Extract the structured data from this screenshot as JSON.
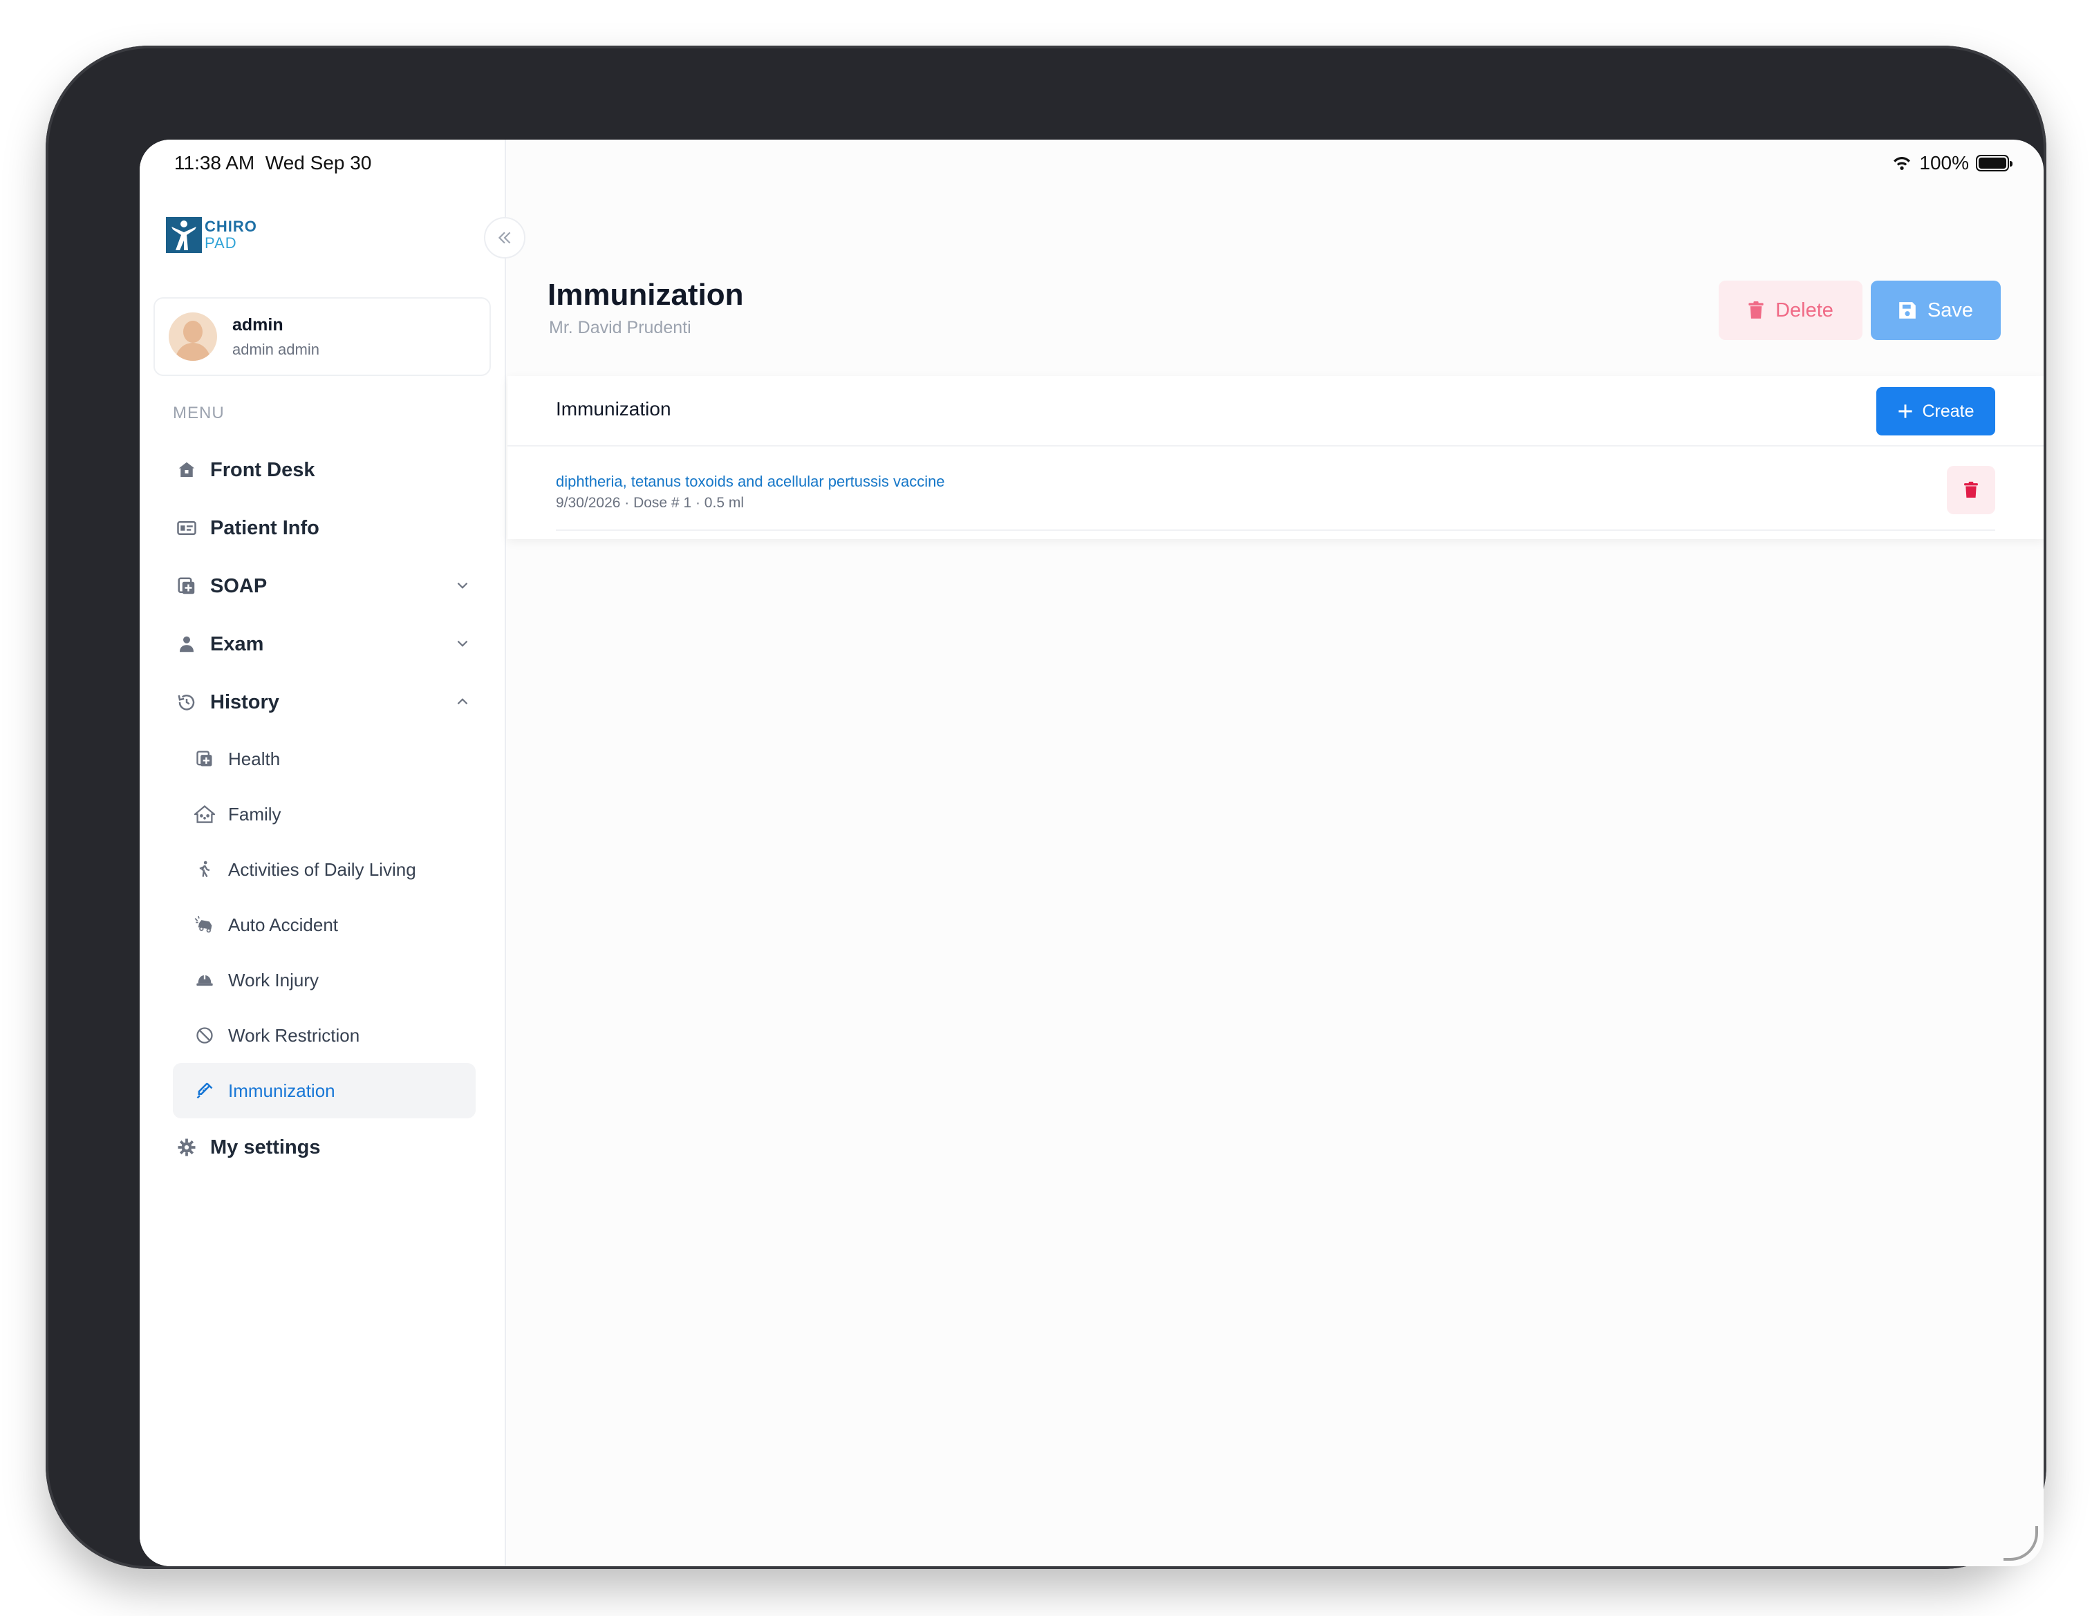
{
  "status_bar": {
    "time": "11:38 AM",
    "date": "Wed Sep 30",
    "battery": "100%"
  },
  "logo": {
    "line1": "CHIRO",
    "line2": "PAD"
  },
  "user": {
    "name": "admin",
    "subtitle": "admin admin"
  },
  "menu": {
    "heading": "MENU",
    "items": [
      {
        "label": "Front Desk",
        "icon": "home-icon"
      },
      {
        "label": "Patient Info",
        "icon": "id-card-icon"
      },
      {
        "label": "SOAP",
        "icon": "medical-doc-icon",
        "expandable": true
      },
      {
        "label": "Exam",
        "icon": "doctor-icon",
        "expandable": true
      },
      {
        "label": "History",
        "icon": "history-icon",
        "expanded": true
      }
    ],
    "history_sub": [
      {
        "label": "Health",
        "icon": "health-icon"
      },
      {
        "label": "Family",
        "icon": "family-icon"
      },
      {
        "label": "Activities of Daily Living",
        "icon": "walking-icon"
      },
      {
        "label": "Auto Accident",
        "icon": "car-crash-icon"
      },
      {
        "label": "Work Injury",
        "icon": "hard-hat-icon"
      },
      {
        "label": "Work Restriction",
        "icon": "ban-icon"
      },
      {
        "label": "Immunization",
        "icon": "syringe-icon",
        "active": true
      }
    ],
    "settings": {
      "label": "My settings",
      "icon": "gear-icon"
    }
  },
  "page": {
    "title": "Immunization",
    "subtitle": "Mr. David Prudenti"
  },
  "actions": {
    "delete": "Delete",
    "save": "Save"
  },
  "panel": {
    "title": "Immunization",
    "create": "Create",
    "records": [
      {
        "name": "diphtheria, tetanus toxoids and acellular pertussis vaccine",
        "meta": "9/30/2026 · Dose # 1 · 0.5 ml"
      }
    ]
  },
  "colors": {
    "accent": "#1a80ee",
    "danger": "#e11d48",
    "active_text": "#1877d6"
  }
}
